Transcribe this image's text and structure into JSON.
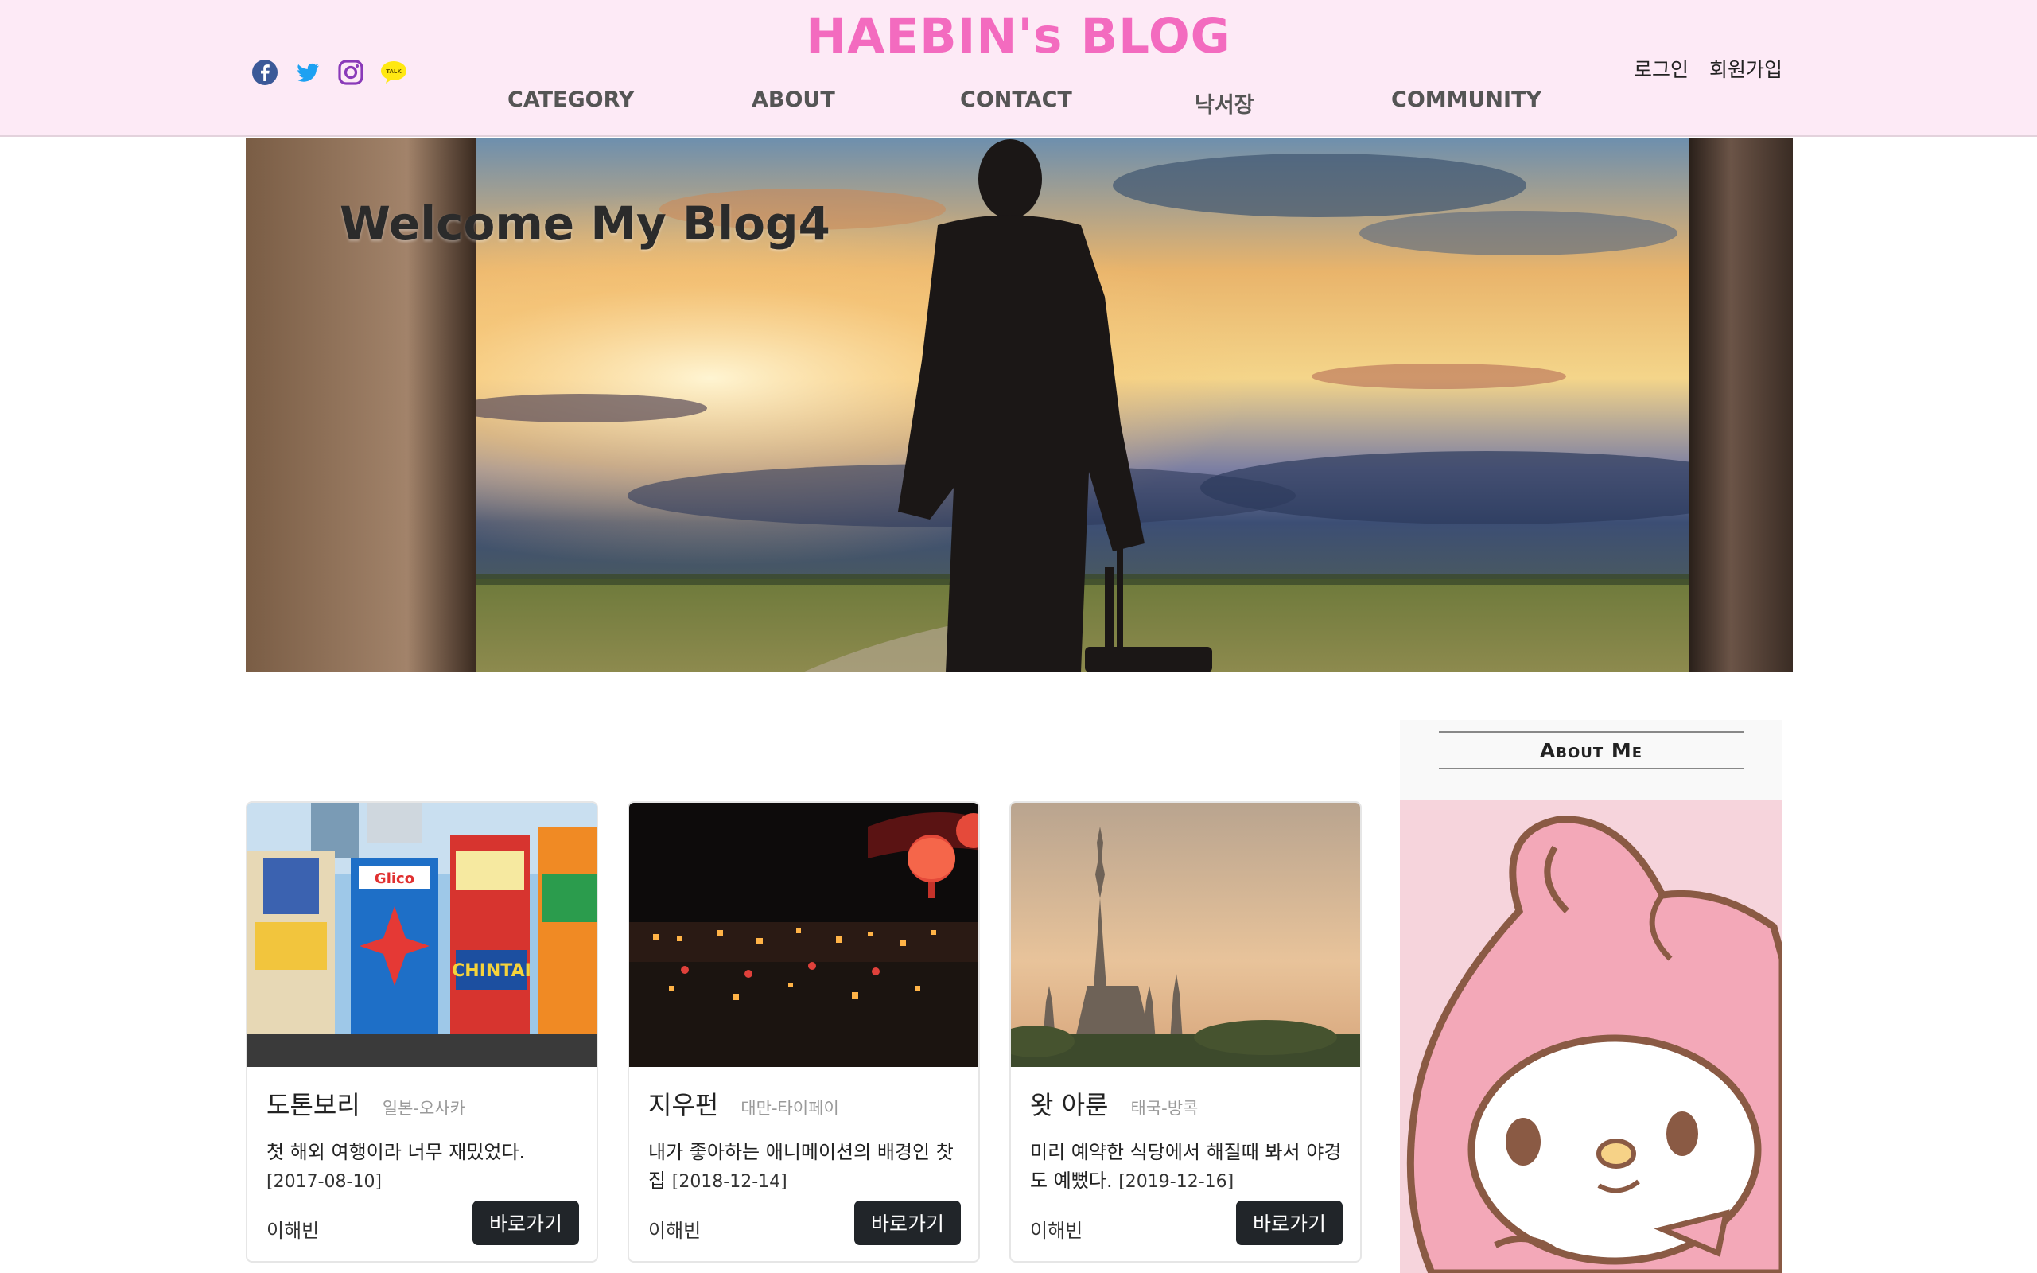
{
  "header": {
    "site_title": "HAEBIN's BLOG",
    "social": [
      {
        "name": "facebook-icon",
        "color": "#3b5998"
      },
      {
        "name": "twitter-icon",
        "color": "#1da1f2"
      },
      {
        "name": "instagram-icon",
        "color": "#8a3ab9"
      },
      {
        "name": "kakaotalk-icon",
        "color": "#ffe812",
        "label": "TALK"
      }
    ],
    "nav": [
      {
        "id": "category",
        "label": "CATEGORY"
      },
      {
        "id": "about",
        "label": "ABOUT"
      },
      {
        "id": "contact",
        "label": "CONTACT"
      },
      {
        "id": "guestbook",
        "label": "낙서장"
      },
      {
        "id": "community",
        "label": "COMMUNITY"
      }
    ],
    "login_label": "로그인",
    "signup_label": "회원가입"
  },
  "hero": {
    "title": "Welcome My Blog4"
  },
  "cards": [
    {
      "title": "도톤보리",
      "location": "일본-오사카",
      "text": "첫 해외 여행이라 너무 재밌었다.",
      "date": "[2017-08-10]",
      "author": "이해빈",
      "button": "바로가기"
    },
    {
      "title": "지우펀",
      "location": "대만-타이페이",
      "text": "내가 좋아하는 애니메이션의 배경인 찻집",
      "date": "[2018-12-14]",
      "author": "이해빈",
      "button": "바로가기"
    },
    {
      "title": "왓 아룬",
      "location": "태국-방콕",
      "text": "미리 예약한 식당에서 해질때 봐서 야경도 예뻤다.",
      "date": "[2019-12-16]",
      "author": "이해빈",
      "button": "바로가기"
    }
  ],
  "about": {
    "heading": "About Me"
  },
  "colors": {
    "header_bg": "#fdeaf6",
    "title_pink": "#f36bbf",
    "button_dark": "#212529"
  }
}
